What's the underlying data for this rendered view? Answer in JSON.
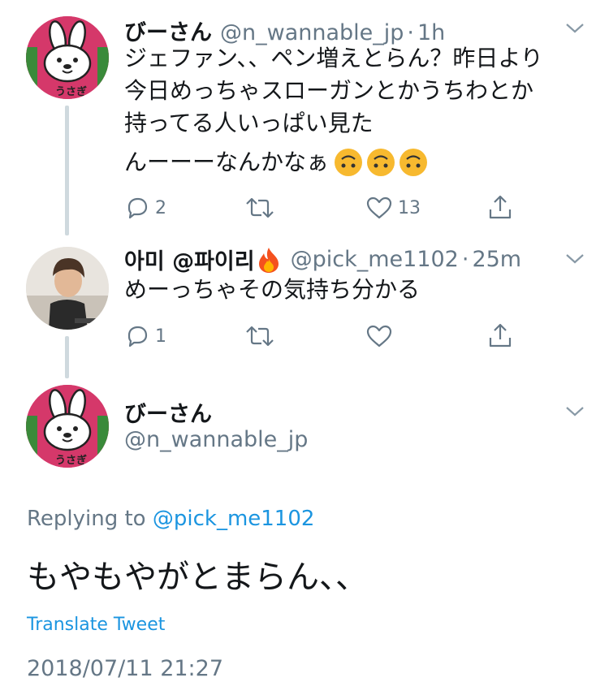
{
  "tweet1": {
    "display_name": "びーさん",
    "handle": "@n_wannable_jp",
    "time": "1h",
    "lines": [
      "ジェファン、、ペン増えとらん？昨日より",
      "今日めっちゃスローガンとかうちわとか",
      "持ってる人いっぱい見た",
      "んーーーなんかなぁ"
    ],
    "emoji": [
      "upside-down-face",
      "upside-down-face",
      "upside-down-face"
    ],
    "reply_count": "2",
    "retweet_count": "",
    "like_count": "13",
    "avatar_text": "うさぎ"
  },
  "tweet2": {
    "display_name": "아미 @파이리",
    "name_emoji": "fire",
    "handle": "@pick_me1102",
    "time": "25m",
    "text": "めーっちゃその気持ち分かる",
    "reply_count": "1",
    "retweet_count": "",
    "like_count": ""
  },
  "main_tweet": {
    "display_name": "びーさん",
    "handle": "@n_wannable_jp",
    "avatar_text": "うさぎ",
    "replying_prefix": "Replying to",
    "replying_handle": "@pick_me1102",
    "text": "もやもやがとまらん、、",
    "translate_label": "Translate Tweet",
    "timestamp": "2018/07/11 21:27"
  },
  "colors": {
    "link": "#1b95e0",
    "meta": "#657786",
    "thread_line": "#cfd9de",
    "avatar_bg": "#d5386a"
  },
  "icons": [
    "reply-icon",
    "retweet-icon",
    "like-icon",
    "share-icon",
    "chevron-down-icon"
  ]
}
